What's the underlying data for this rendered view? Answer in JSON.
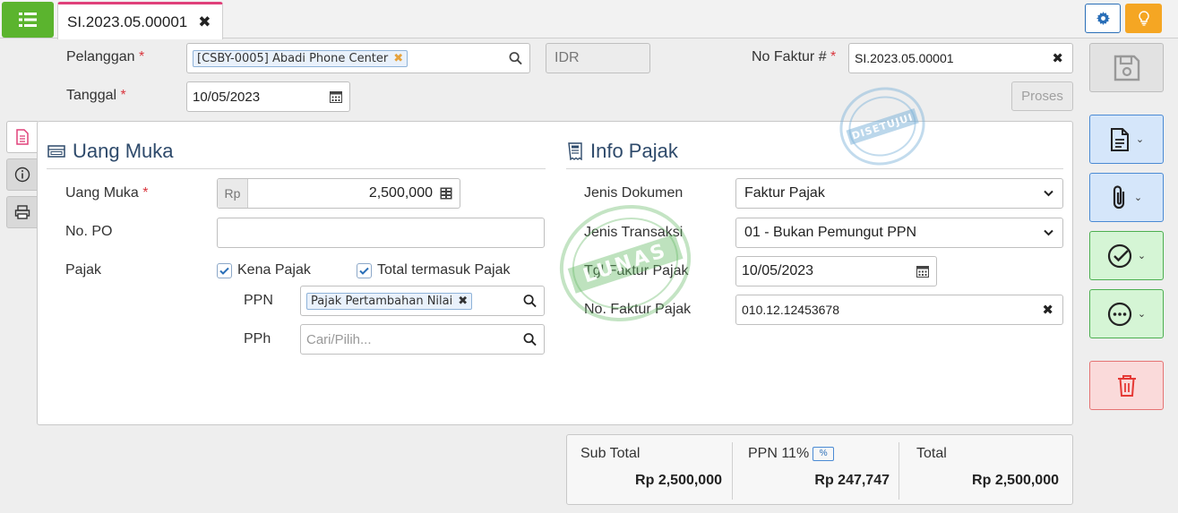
{
  "tab": {
    "title": "SI.2023.05.00001"
  },
  "header": {
    "customer_label": "Pelanggan",
    "customer_value": "[CSBY-0005] Abadi Phone Center",
    "currency": "IDR",
    "invoice_no_label": "No Faktur #",
    "invoice_no_value": "SI.2023.05.00001",
    "date_label": "Tanggal",
    "date_value": "10/05/2023",
    "process_label": "Proses",
    "required_mark": "*"
  },
  "down_payment": {
    "title": "Uang Muka",
    "amount_label": "Uang Muka",
    "currency_prefix": "Rp",
    "amount_value": "2,500,000",
    "po_label": "No. PO",
    "po_value": "",
    "tax_label": "Pajak",
    "taxable_label": "Kena Pajak",
    "tax_included_label": "Total termasuk Pajak",
    "ppn_label": "PPN",
    "ppn_value": "Pajak Pertambahan Nilai",
    "pph_label": "PPh",
    "pph_placeholder": "Cari/Pilih..."
  },
  "tax_info": {
    "title": "Info Pajak",
    "doc_type_label": "Jenis Dokumen",
    "doc_type_value": "Faktur Pajak",
    "trans_type_label": "Jenis Transaksi",
    "trans_type_value": "01 - Bukan Pemungut PPN",
    "tax_date_label": "Tgl Faktur Pajak",
    "tax_date_value": "10/05/2023",
    "tax_no_label": "No. Faktur Pajak",
    "tax_no_value": "010.12.12453678"
  },
  "stamps": {
    "approved": "DISETUJUI",
    "paid": "LUNAS"
  },
  "totals": {
    "subtotal_label": "Sub Total",
    "subtotal_value": "Rp 2,500,000",
    "ppn_label": "PPN 11%",
    "ppn_badge": "%",
    "ppn_value": "Rp 247,747",
    "total_label": "Total",
    "total_value": "Rp 2,500,000"
  },
  "colors": {
    "menu_green": "#5bb42e",
    "tab_accent": "#e0407a",
    "bulb_orange": "#f5a623",
    "title_blue": "#2e4a6b"
  }
}
